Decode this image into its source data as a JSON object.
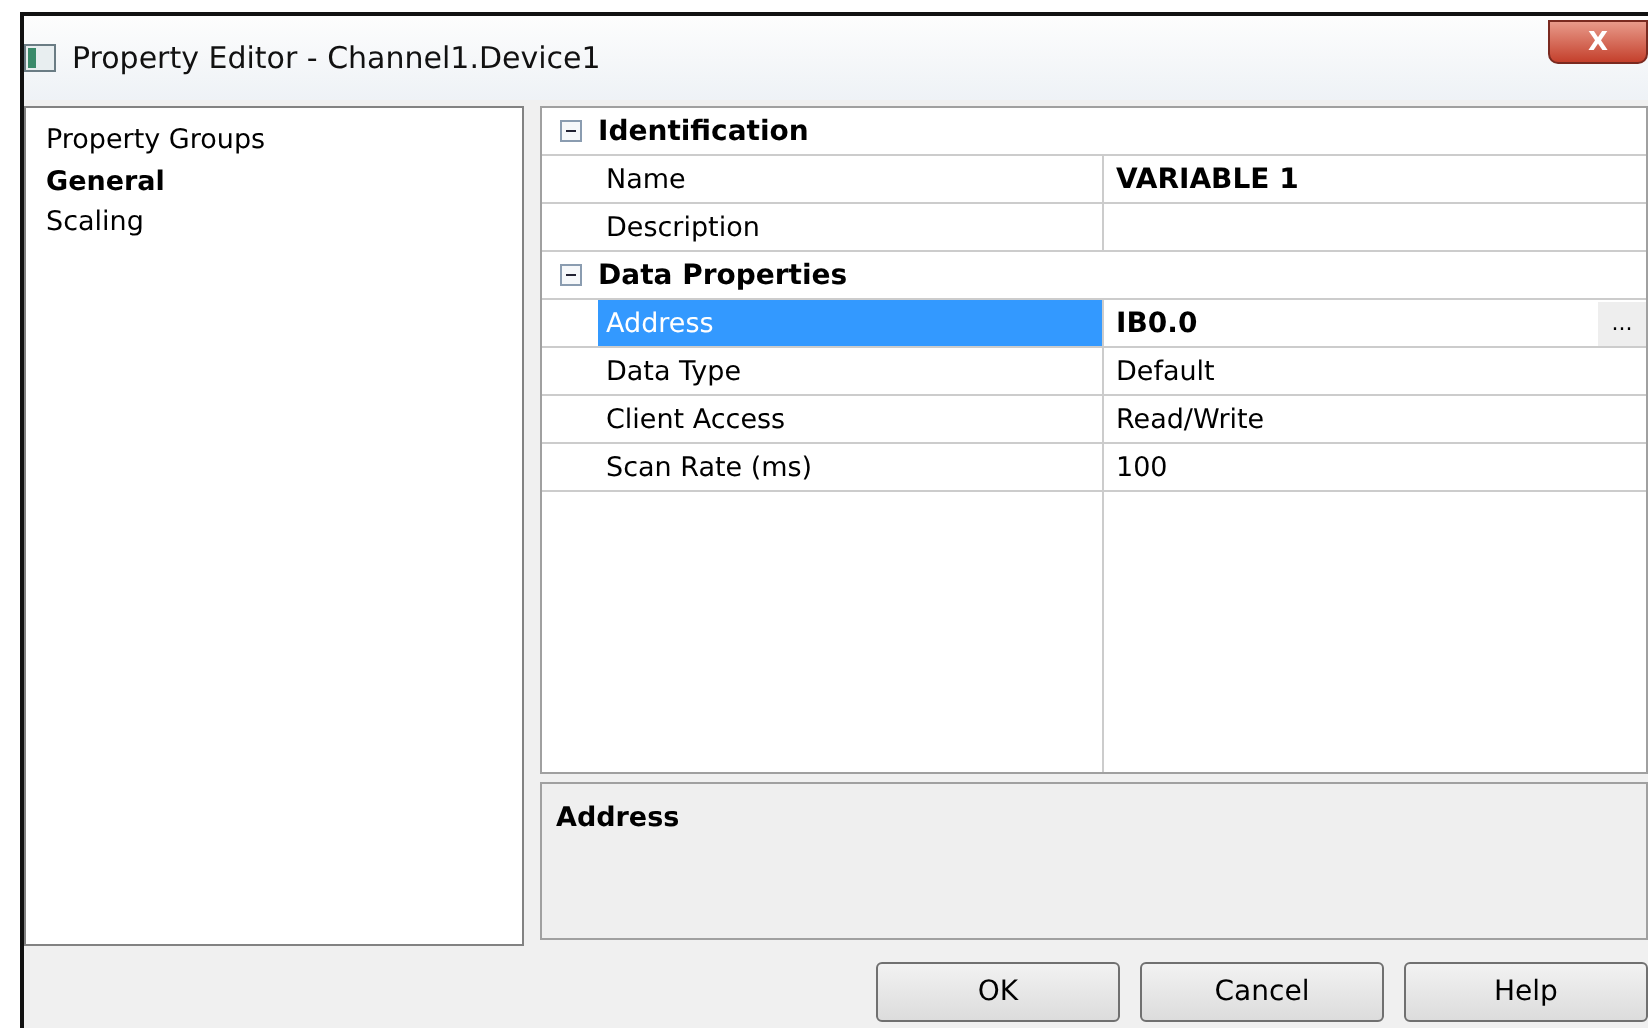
{
  "window": {
    "title": "Property Editor - Channel1.Device1",
    "close": "X"
  },
  "groups": {
    "header": "Property Groups",
    "items": [
      {
        "label": "General",
        "selected": true
      },
      {
        "label": "Scaling",
        "selected": false
      }
    ]
  },
  "grid": {
    "categories": [
      {
        "label": "Identification",
        "expanded": true,
        "rows": [
          {
            "name": "Name",
            "value": "VARIABLE 1",
            "modified": true,
            "selected": false
          },
          {
            "name": "Description",
            "selected": false
          }
        ]
      },
      {
        "label": "Data Properties",
        "expanded": true,
        "rows": [
          {
            "name": "Address",
            "value": "IB0.0",
            "modified": true,
            "selected": true,
            "browse": "..."
          },
          {
            "name": "Data Type",
            "value": "Default",
            "modified": false,
            "selected": false
          },
          {
            "name": "Client Access",
            "value": "Read/Write",
            "modified": false,
            "selected": false
          },
          {
            "name": "Scan Rate (ms)",
            "value": "100",
            "modified": false,
            "selected": false
          }
        ]
      }
    ]
  },
  "help_panel": {
    "title": "Address"
  },
  "buttons": [
    "OK",
    "Cancel",
    "Help"
  ]
}
